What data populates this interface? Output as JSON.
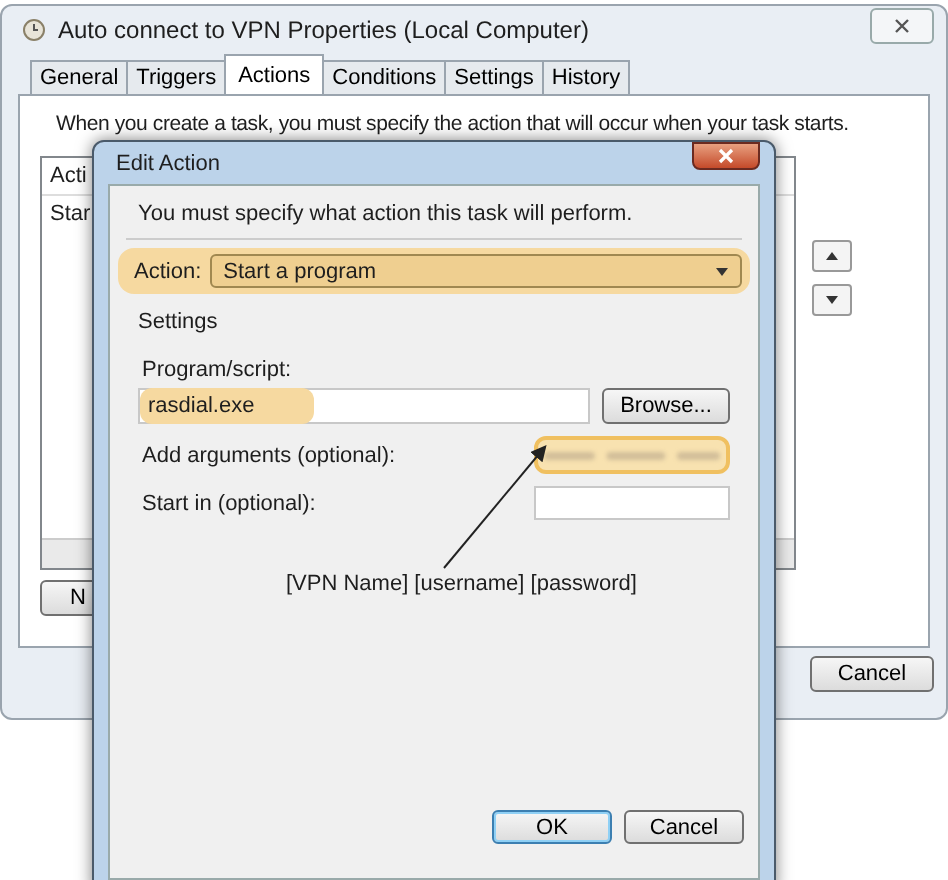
{
  "window": {
    "title": "Auto connect to VPN Properties (Local Computer)"
  },
  "tabs": [
    {
      "label": "General",
      "selected": false
    },
    {
      "label": "Triggers",
      "selected": false
    },
    {
      "label": "Actions",
      "selected": true
    },
    {
      "label": "Conditions",
      "selected": false
    },
    {
      "label": "Settings",
      "selected": false
    },
    {
      "label": "History",
      "selected": false
    }
  ],
  "panel": {
    "intro": "When you create a task, you must specify the action that will occur when your task starts.",
    "list_header": "Acti",
    "list_row": "Star",
    "new_button": "N"
  },
  "buttons": [
    "Cancel"
  ],
  "dialog": {
    "title": "Edit Action",
    "intro": "You must specify what action this task will perform.",
    "action": {
      "label": "Action:",
      "value": "Start a program",
      "highlighted": true
    },
    "settings_label": "Settings",
    "program": {
      "label": "Program/script:",
      "value": "rasdial.exe",
      "highlighted": true,
      "browse": "Browse..."
    },
    "arguments": {
      "label": "Add arguments (optional):",
      "highlighted": true
    },
    "start_in": {
      "label": "Start in (optional):"
    },
    "buttons": [
      "OK",
      "Cancel"
    ]
  },
  "annotation": "[VPN Name] [username] [password]"
}
